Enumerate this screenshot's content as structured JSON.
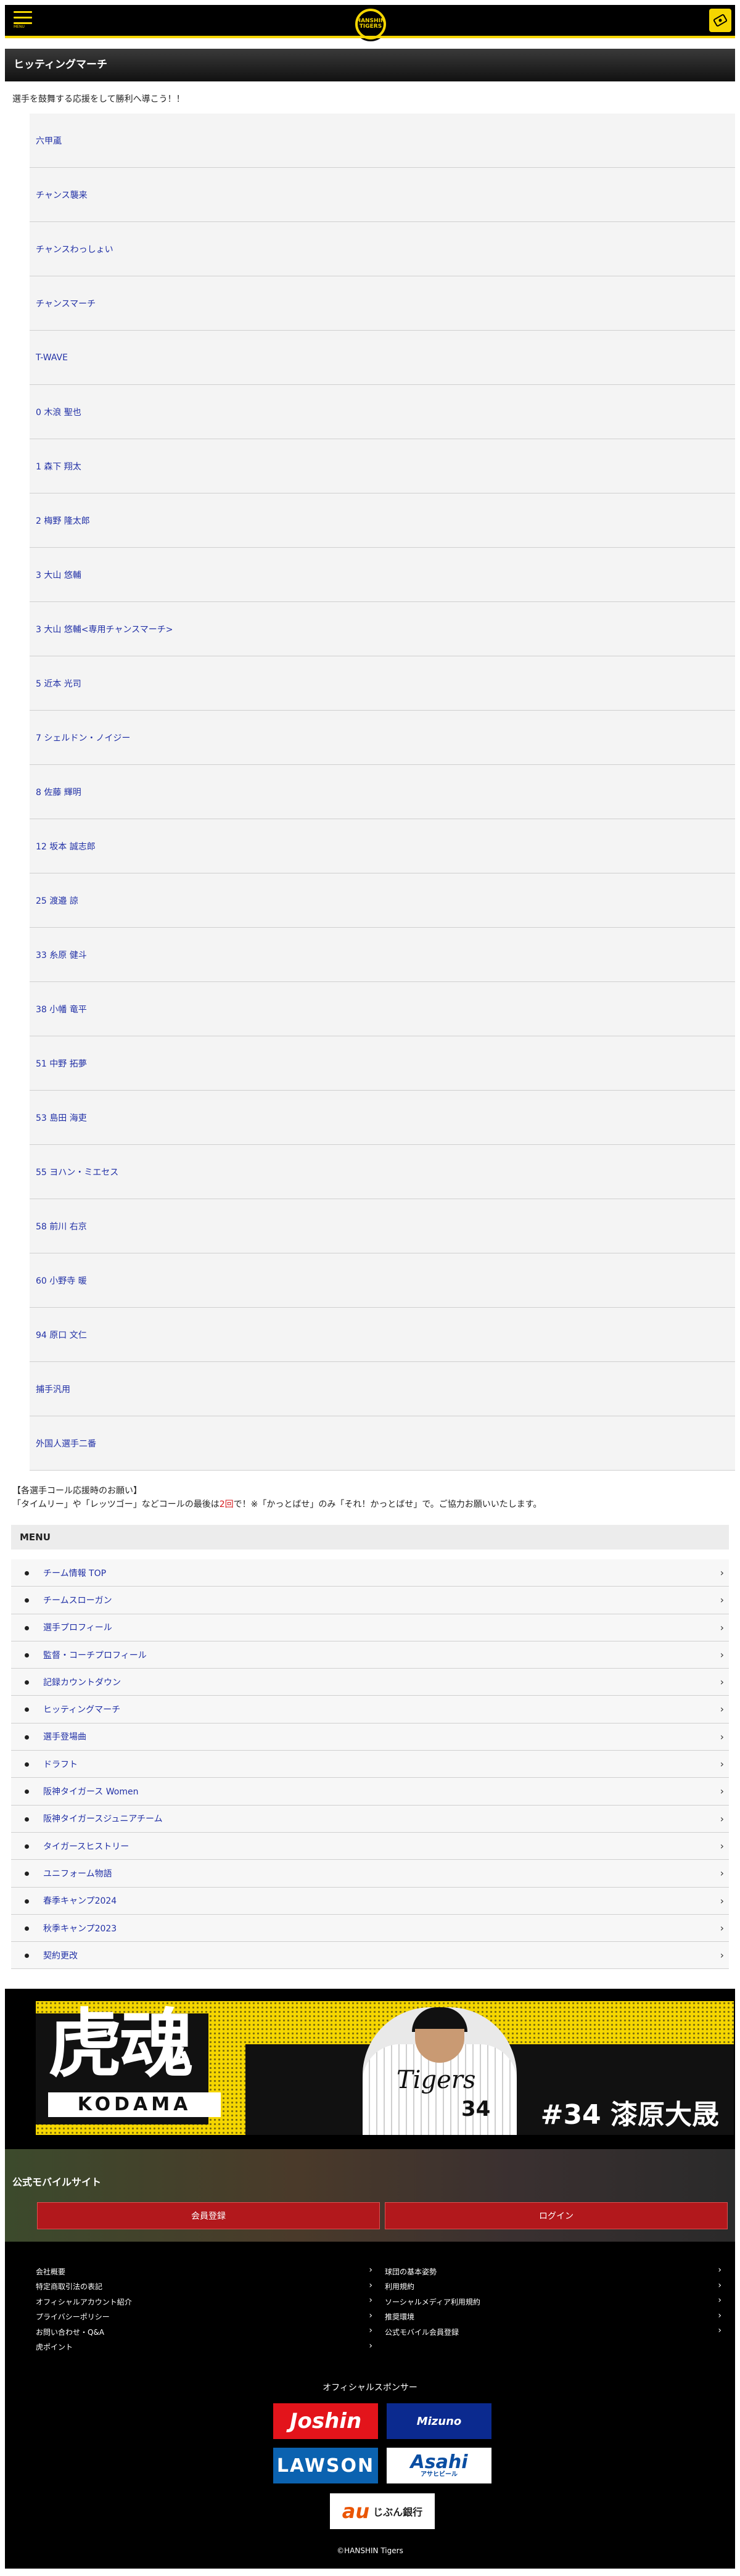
{
  "header": {
    "menu_text": "MENU",
    "logo_text": "HANSHIN TIGERS",
    "ticket_icon": "ticket-icon"
  },
  "page": {
    "title": "ヒッティングマーチ",
    "intro": "選手を鼓舞する応援をして勝利へ導こう！！"
  },
  "songs": [
    "六甲颪",
    "チャンス襲来",
    "チャンスわっしょい",
    "チャンスマーチ",
    "T-WAVE",
    "0 木浪 聖也",
    "1 森下 翔太",
    "2 梅野 隆太郎",
    "3 大山 悠輔",
    "3 大山 悠輔<専用チャンスマーチ>",
    "5 近本 光司",
    "7 シェルドン・ノイジー",
    "8 佐藤 輝明",
    "12 坂本 誠志郎",
    "25 渡邉 諒",
    "33 糸原 健斗",
    "38 小幡 竜平",
    "51 中野 拓夢",
    "53 島田 海吏",
    "55 ヨハン・ミエセス",
    "58 前川 右京",
    "60 小野寺 暖",
    "94 原口 文仁",
    "捕手汎用",
    "外国人選手二番"
  ],
  "note": {
    "heading": "【各選手コール応援時のお願い】",
    "line_a": "「タイムリー」や「レッツゴー」などコールの最後は",
    "line_red": "2回",
    "line_b": "で！※「かっとばせ」のみ「それ！かっとばせ」で。ご協力お願いいたします。"
  },
  "menu": {
    "heading": "MENU",
    "items": [
      "チーム情報 TOP",
      "チームスローガン",
      "選手プロフィール",
      "監督・コーチプロフィール",
      "記録カウントダウン",
      "ヒッティングマーチ",
      "選手登場曲",
      "ドラフト",
      "阪神タイガース Women",
      "阪神タイガースジュニアチーム",
      "タイガースヒストリー",
      "ユニフォーム物語",
      "春季キャンプ2024",
      "秋季キャンプ2023",
      "契約更改"
    ]
  },
  "banner": {
    "kanji": "虎魂",
    "kodama": "KODAMA",
    "jersey_text": "Tigers",
    "jersey_number": "34",
    "caption": "#34 漆原大晟"
  },
  "mobile": {
    "title": "公式モバイルサイト",
    "register": "会員登録",
    "login": "ログイン"
  },
  "footer_links": {
    "left": [
      "会社概要",
      "特定商取引法の表記",
      "オフィシャルアカウント紹介",
      "プライバシーポリシー",
      "お問い合わせ・Q&A",
      "虎ポイント"
    ],
    "right": [
      "球団の基本姿勢",
      "利用規約",
      "ソーシャルメディア利用規約",
      "推奨環境",
      "公式モバイル会員登録"
    ]
  },
  "sponsors": {
    "title": "オフィシャルスポンサー",
    "joshin": "Joshin",
    "mizuno": "Mizuno",
    "lawson": "LAWSON",
    "asahi": "Asahi",
    "asahi_sub": "アサヒビール",
    "au_mark": "au",
    "au_bank": "じぶん銀行"
  },
  "copyright": "©HANSHIN Tigers",
  "colors": {
    "brand_yellow": "#f5d600",
    "link_blue": "#2130a6",
    "button_red": "#b2181c",
    "note_red": "#d4161a"
  }
}
